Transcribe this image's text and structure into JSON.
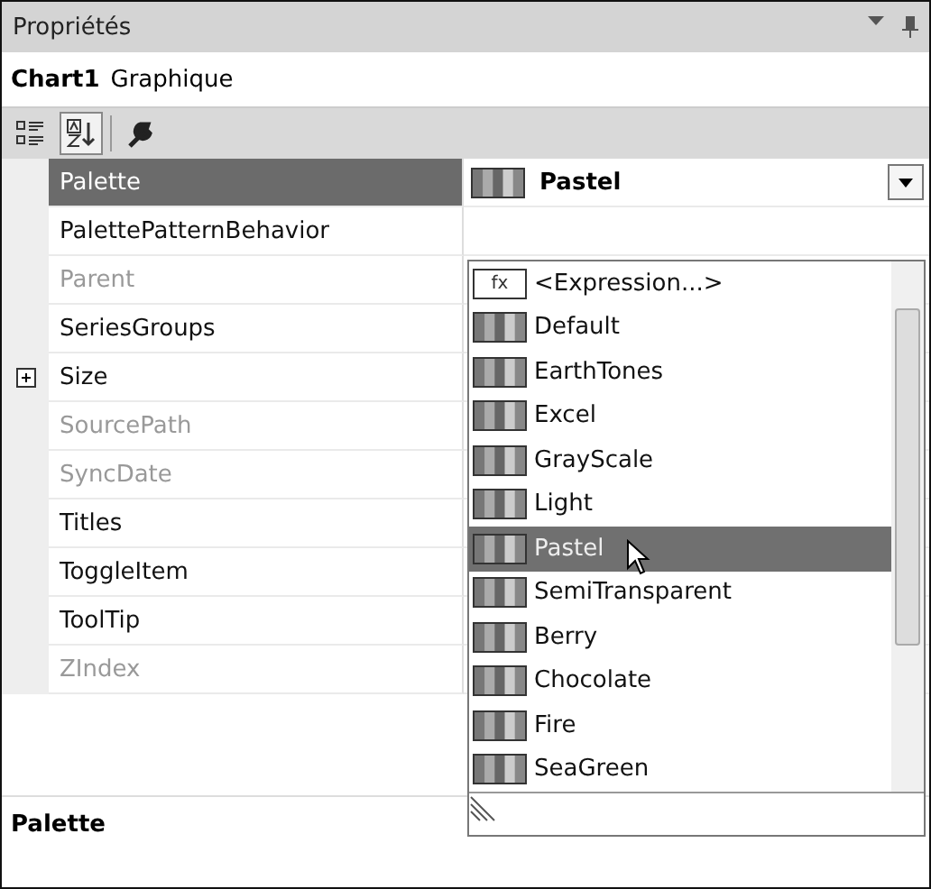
{
  "window": {
    "title": "Propriétés"
  },
  "object": {
    "name": "Chart1",
    "type": "Graphique"
  },
  "toolbar": [
    {
      "kind": "categorized",
      "selected": false
    },
    {
      "kind": "alphabetical",
      "selected": true
    },
    {
      "kind": "property-pages",
      "selected": false
    }
  ],
  "properties": [
    {
      "name": "Palette",
      "selected": true,
      "disabled": false,
      "expandable": false,
      "value": "Pastel"
    },
    {
      "name": "PalettePatternBehavior",
      "selected": false,
      "disabled": false,
      "expandable": false
    },
    {
      "name": "Parent",
      "selected": false,
      "disabled": true,
      "expandable": false
    },
    {
      "name": "SeriesGroups",
      "selected": false,
      "disabled": false,
      "expandable": false
    },
    {
      "name": "Size",
      "selected": false,
      "disabled": false,
      "expandable": true
    },
    {
      "name": "SourcePath",
      "selected": false,
      "disabled": true,
      "expandable": false
    },
    {
      "name": "SyncDate",
      "selected": false,
      "disabled": true,
      "expandable": false
    },
    {
      "name": "Titles",
      "selected": false,
      "disabled": false,
      "expandable": false
    },
    {
      "name": "ToggleItem",
      "selected": false,
      "disabled": false,
      "expandable": false
    },
    {
      "name": "ToolTip",
      "selected": false,
      "disabled": false,
      "expandable": false
    },
    {
      "name": "ZIndex",
      "selected": false,
      "disabled": true,
      "expandable": false
    }
  ],
  "dropdown": {
    "items": [
      {
        "label": "<Expression...>",
        "kind": "expression",
        "icon_label": "fx",
        "selected": false
      },
      {
        "label": "Default",
        "kind": "palette",
        "selected": false
      },
      {
        "label": "EarthTones",
        "kind": "palette",
        "selected": false
      },
      {
        "label": "Excel",
        "kind": "palette",
        "selected": false
      },
      {
        "label": "GrayScale",
        "kind": "palette",
        "selected": false
      },
      {
        "label": "Light",
        "kind": "palette",
        "selected": false
      },
      {
        "label": "Pastel",
        "kind": "palette",
        "selected": true
      },
      {
        "label": "SemiTransparent",
        "kind": "palette",
        "selected": false
      },
      {
        "label": "Berry",
        "kind": "palette",
        "selected": false
      },
      {
        "label": "Chocolate",
        "kind": "palette",
        "selected": false
      },
      {
        "label": "Fire",
        "kind": "palette",
        "selected": false
      },
      {
        "label": "SeaGreen",
        "kind": "palette",
        "selected": false
      }
    ]
  },
  "description": {
    "title": "Palette"
  }
}
